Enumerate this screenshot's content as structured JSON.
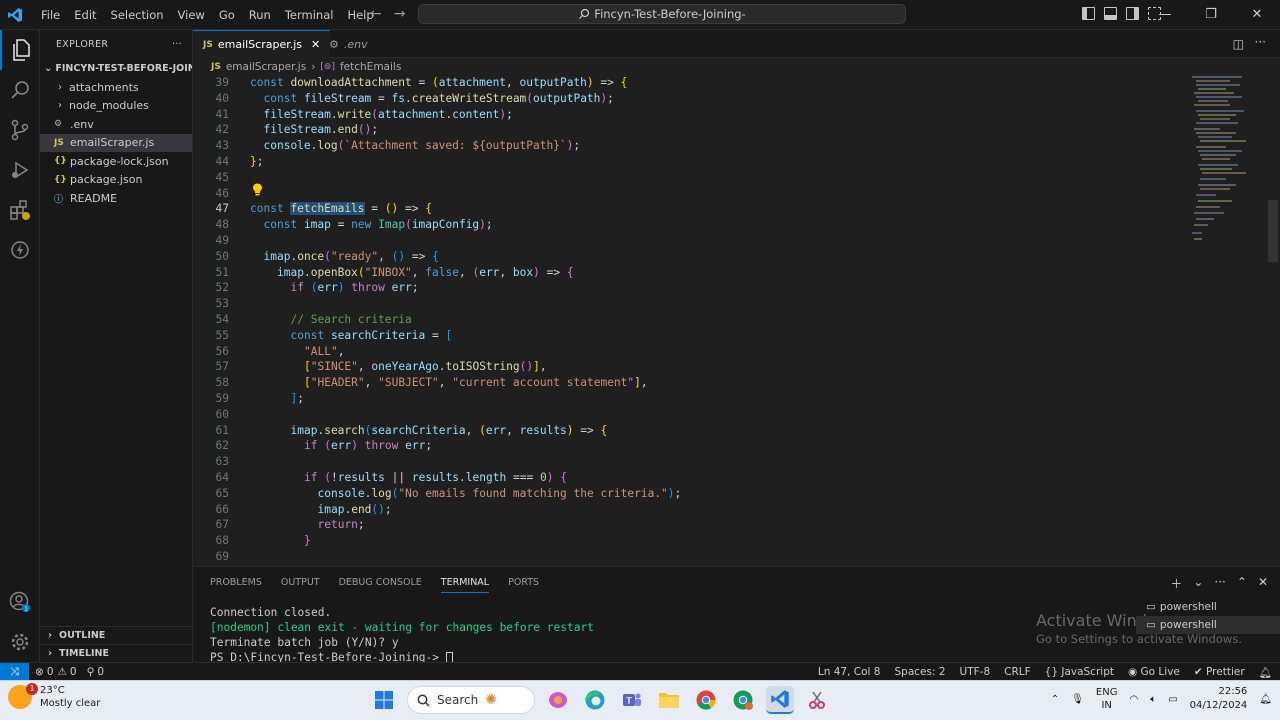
{
  "menu": [
    "File",
    "Edit",
    "Selection",
    "View",
    "Go",
    "Run",
    "Terminal",
    "Help"
  ],
  "command_center": "Fincyn-Test-Before-Joining-",
  "sidebar": {
    "title": "EXPLORER",
    "folder": "FINCYN-TEST-BEFORE-JOINI...",
    "items": [
      {
        "label": "attachments",
        "type": "folder"
      },
      {
        "label": "node_modules",
        "type": "folder"
      },
      {
        "label": ".env",
        "type": "env"
      },
      {
        "label": "emailScraper.js",
        "type": "js",
        "icon_text": "JS"
      },
      {
        "label": "package-lock.json",
        "type": "json",
        "icon_text": "{}"
      },
      {
        "label": "package.json",
        "type": "json",
        "icon_text": "{}"
      },
      {
        "label": "README",
        "type": "info",
        "icon_text": "ⓘ"
      }
    ],
    "outline": "OUTLINE",
    "timeline": "TIMELINE"
  },
  "tabs": [
    {
      "label": "emailScraper.js",
      "icon_text": "JS",
      "active": true
    },
    {
      "label": ".env",
      "active": false
    }
  ],
  "breadcrumb": {
    "file": "emailScraper.js",
    "file_icon_text": "JS",
    "symbol": "fetchEmails",
    "symbol_icon_text": "[⊚]"
  },
  "editor": {
    "current_line": 47,
    "lines": [
      {
        "n": 39,
        "text": "const downloadAttachment = (attachment, outputPath) => {"
      },
      {
        "n": 40,
        "text": "  const fileStream = fs.createWriteStream(outputPath);"
      },
      {
        "n": 41,
        "text": "  fileStream.write(attachment.content);"
      },
      {
        "n": 42,
        "text": "  fileStream.end();"
      },
      {
        "n": 43,
        "text": "  console.log(`Attachment saved: ${outputPath}`);"
      },
      {
        "n": 44,
        "text": "};"
      },
      {
        "n": 45,
        "text": ""
      },
      {
        "n": 46,
        "text": ""
      },
      {
        "n": 47,
        "text": "const fetchEmails = () => {"
      },
      {
        "n": 48,
        "text": "  const imap = new Imap(imapConfig);"
      },
      {
        "n": 49,
        "text": ""
      },
      {
        "n": 50,
        "text": "  imap.once(\"ready\", () => {"
      },
      {
        "n": 51,
        "text": "    imap.openBox(\"INBOX\", false, (err, box) => {"
      },
      {
        "n": 52,
        "text": "      if (err) throw err;"
      },
      {
        "n": 53,
        "text": ""
      },
      {
        "n": 54,
        "text": "      // Search criteria"
      },
      {
        "n": 55,
        "text": "      const searchCriteria = ["
      },
      {
        "n": 56,
        "text": "        \"ALL\","
      },
      {
        "n": 57,
        "text": "        [\"SINCE\", oneYearAgo.toISOString()],"
      },
      {
        "n": 58,
        "text": "        [\"HEADER\", \"SUBJECT\", \"current account statement\"],"
      },
      {
        "n": 59,
        "text": "      ];"
      },
      {
        "n": 60,
        "text": ""
      },
      {
        "n": 61,
        "text": "      imap.search(searchCriteria, (err, results) => {"
      },
      {
        "n": 62,
        "text": "        if (err) throw err;"
      },
      {
        "n": 63,
        "text": ""
      },
      {
        "n": 64,
        "text": "        if (!results || results.length === 0) {"
      },
      {
        "n": 65,
        "text": "          console.log(\"No emails found matching the criteria.\");"
      },
      {
        "n": 66,
        "text": "          imap.end();"
      },
      {
        "n": 67,
        "text": "          return;"
      },
      {
        "n": 68,
        "text": "        }"
      },
      {
        "n": 69,
        "text": ""
      }
    ]
  },
  "panel": {
    "tabs": [
      "PROBLEMS",
      "OUTPUT",
      "DEBUG CONSOLE",
      "TERMINAL",
      "PORTS"
    ],
    "active_tab": "TERMINAL",
    "terminal_lines": [
      "Connection closed.",
      "[nodemon] clean exit - waiting for changes before restart",
      "Terminate batch job (Y/N)? y",
      "PS D:\\Fincyn-Test-Before-Joining-> "
    ],
    "shells": [
      "powershell",
      "powershell"
    ],
    "watermark": {
      "title": "Activate Windows",
      "subtitle": "Go to Settings to activate Windows."
    }
  },
  "statusbar": {
    "errors": "0",
    "warnings": "0",
    "ports": "0",
    "position": "Ln 47, Col 8",
    "spaces": "Spaces: 2",
    "encoding": "UTF-8",
    "eol": "CRLF",
    "language": "JavaScript",
    "golive": "Go Live",
    "prettier": "Prettier"
  },
  "taskbar": {
    "temp": "23°C",
    "weather": "Mostly clear",
    "weather_badge": "1",
    "search_placeholder": "Search",
    "lang1": "ENG",
    "lang2": "IN",
    "time": "22:56",
    "date": "04/12/2024"
  },
  "colors": {
    "accent": "#0078d4",
    "editor_bg": "#1f1f1f",
    "chrome_bg": "#181818"
  }
}
